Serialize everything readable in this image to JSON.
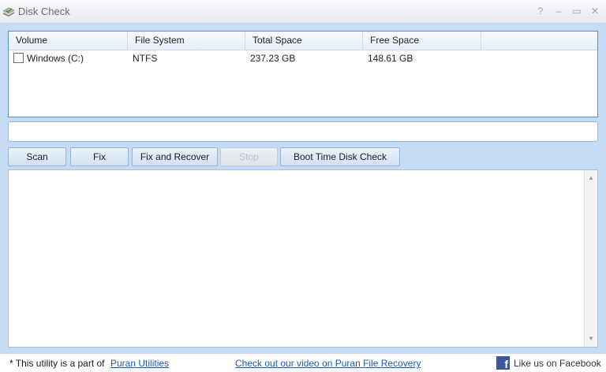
{
  "window": {
    "title": "Disk Check",
    "controls": [
      "?",
      "–",
      "▭",
      "✕"
    ]
  },
  "volume_list": {
    "columns": [
      "Volume",
      "File System",
      "Total Space",
      "Free Space"
    ],
    "rows": [
      {
        "checked": false,
        "volume": "Windows (C:)",
        "file_system": "NTFS",
        "total_space": "237.23 GB",
        "free_space": "148.61 GB"
      }
    ]
  },
  "path_field": {
    "value": ""
  },
  "toolbar": {
    "scan_label": "Scan",
    "fix_label": "Fix",
    "fix_recover_label": "Fix and Recover",
    "stop_label": "Stop",
    "boot_check_label": "Boot Time Disk Check"
  },
  "output": {
    "text": ""
  },
  "statusbar": {
    "prefix": "* This utility is a part of",
    "utilities_link": "Puran Utilities",
    "video_link": "Check out our video on Puran File Recovery",
    "facebook_label": "Like us on Facebook",
    "facebook_glyph": "f"
  },
  "colors": {
    "background": "#c6dcf4",
    "accent_border": "#5b8ed4",
    "link": "#1a57c9",
    "facebook": "#3b5998"
  }
}
